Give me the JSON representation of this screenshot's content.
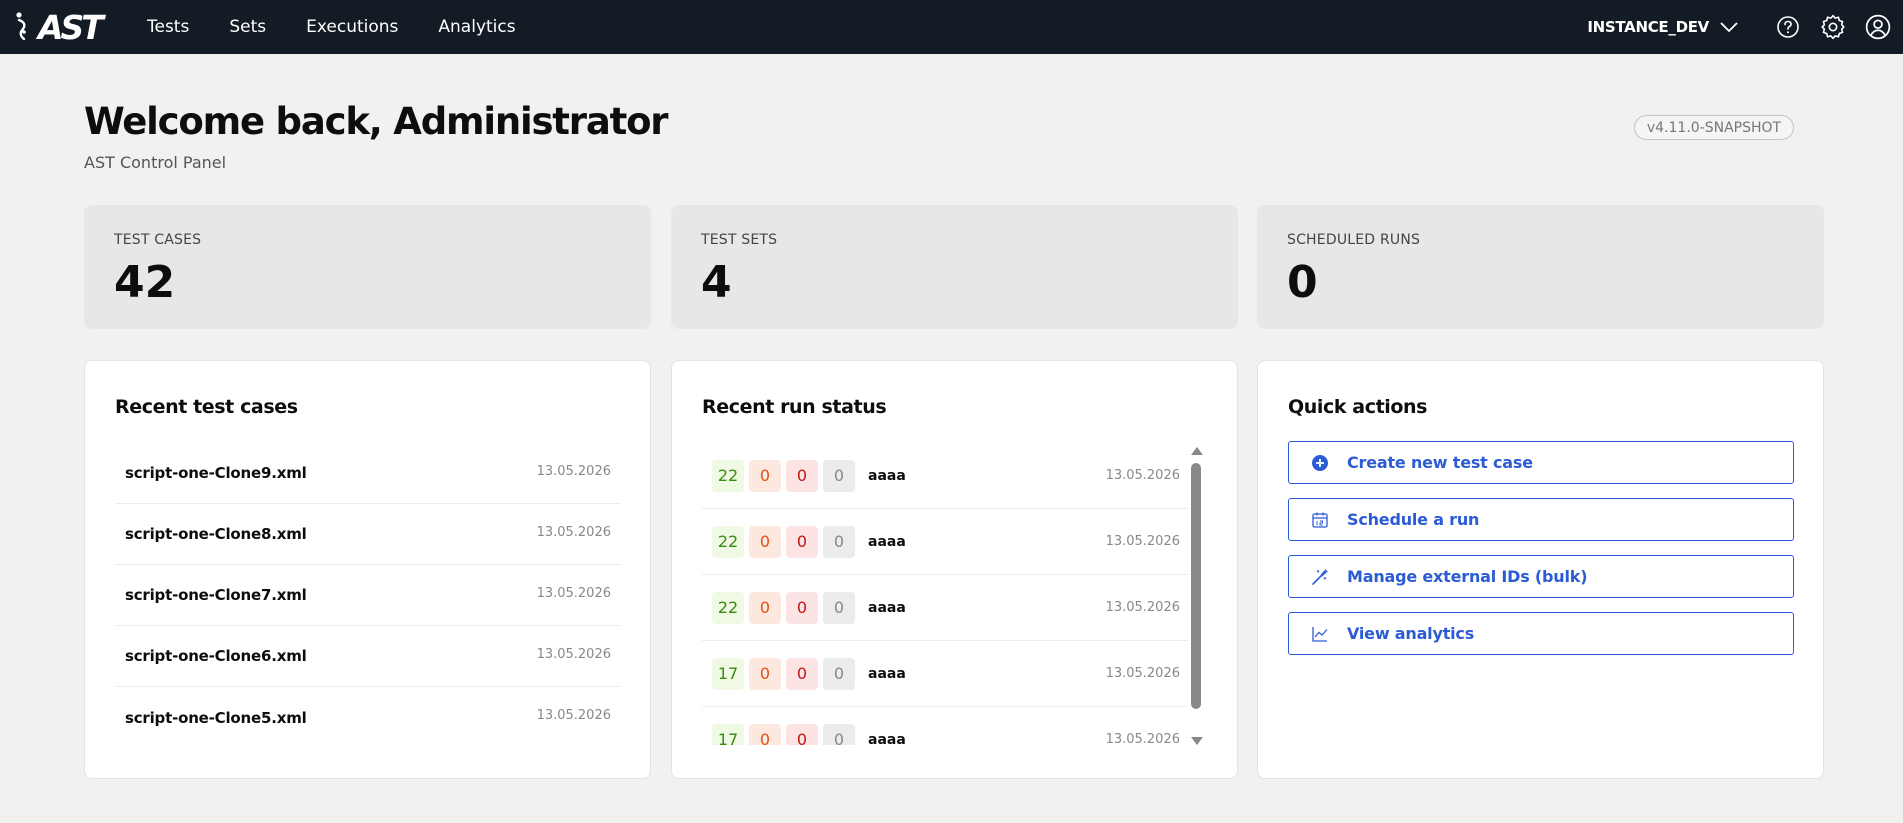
{
  "nav": {
    "logo_text": "AST",
    "links": [
      "Tests",
      "Sets",
      "Executions",
      "Analytics"
    ],
    "instance": "INSTANCE_DEV",
    "icons": [
      "help-icon",
      "gear-icon",
      "user-icon"
    ]
  },
  "header": {
    "welcome": "Welcome back, Administrator",
    "subtitle": "AST Control Panel",
    "version": "v4.11.0-SNAPSHOT"
  },
  "stats": [
    {
      "label": "TEST CASES",
      "value": "42"
    },
    {
      "label": "TEST SETS",
      "value": "4"
    },
    {
      "label": "SCHEDULED RUNS",
      "value": "0"
    }
  ],
  "recent_tests": {
    "title": "Recent test cases",
    "items": [
      {
        "name": "script-one-Clone9.xml",
        "date": "13.05.2026"
      },
      {
        "name": "script-one-Clone8.xml",
        "date": "13.05.2026"
      },
      {
        "name": "script-one-Clone7.xml",
        "date": "13.05.2026"
      },
      {
        "name": "script-one-Clone6.xml",
        "date": "13.05.2026"
      },
      {
        "name": "script-one-Clone5.xml",
        "date": "13.05.2026"
      }
    ]
  },
  "recent_runs": {
    "title": "Recent run status",
    "items": [
      {
        "pass": "22",
        "fail": "0",
        "error": "0",
        "skip": "0",
        "name": "aaaa",
        "date": "13.05.2026"
      },
      {
        "pass": "22",
        "fail": "0",
        "error": "0",
        "skip": "0",
        "name": "aaaa",
        "date": "13.05.2026"
      },
      {
        "pass": "22",
        "fail": "0",
        "error": "0",
        "skip": "0",
        "name": "aaaa",
        "date": "13.05.2026"
      },
      {
        "pass": "17",
        "fail": "0",
        "error": "0",
        "skip": "0",
        "name": "aaaa",
        "date": "13.05.2026"
      },
      {
        "pass": "17",
        "fail": "0",
        "error": "0",
        "skip": "0",
        "name": "aaaa",
        "date": "13.05.2026"
      }
    ]
  },
  "quick_actions": {
    "title": "Quick actions",
    "items": [
      {
        "label": "Create new test case",
        "icon": "plus-circle-icon"
      },
      {
        "label": "Schedule a run",
        "icon": "calendar-icon"
      },
      {
        "label": "Manage external IDs (bulk)",
        "icon": "magic-wand-icon"
      },
      {
        "label": "View analytics",
        "icon": "chart-line-icon"
      }
    ]
  },
  "colors": {
    "nav_bg": "#131b24",
    "accent": "#2c5bd6",
    "pass": "#3b8a13",
    "fail": "#e04f1b",
    "error": "#c01616"
  }
}
